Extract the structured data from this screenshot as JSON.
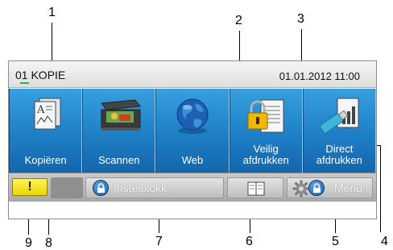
{
  "callouts": {
    "c1": "1",
    "c2": "2",
    "c3": "3",
    "c4": "4",
    "c5": "5",
    "c6": "6",
    "c7": "7",
    "c8": "8",
    "c9": "9"
  },
  "status": {
    "slot_number": "01",
    "mode": "KOPIE",
    "datetime": "01.01.2012 11:00"
  },
  "tiles": [
    {
      "label": "Kopiëren",
      "icon": "copy-document-icon"
    },
    {
      "label": "Scannen",
      "icon": "scanner-icon"
    },
    {
      "label": "Web",
      "icon": "globe-icon"
    },
    {
      "label_line1": "Veilig",
      "label_line2": "afdrukken",
      "icon": "secure-print-lock-icon"
    },
    {
      "label_line1": "Direct",
      "label_line2": "afdrukken",
      "icon": "usb-drive-icon"
    }
  ],
  "bottom": {
    "warning_label": "!",
    "settings_label": "Instelblokk.",
    "menu_label": "Menu",
    "icons": [
      "lock-icon",
      "address-book-icon",
      "gear-icon"
    ]
  },
  "colors": {
    "tile_blue": "#1f7fc6",
    "warning_yellow": "#f2e21a",
    "status_green": "#2fb34a"
  }
}
